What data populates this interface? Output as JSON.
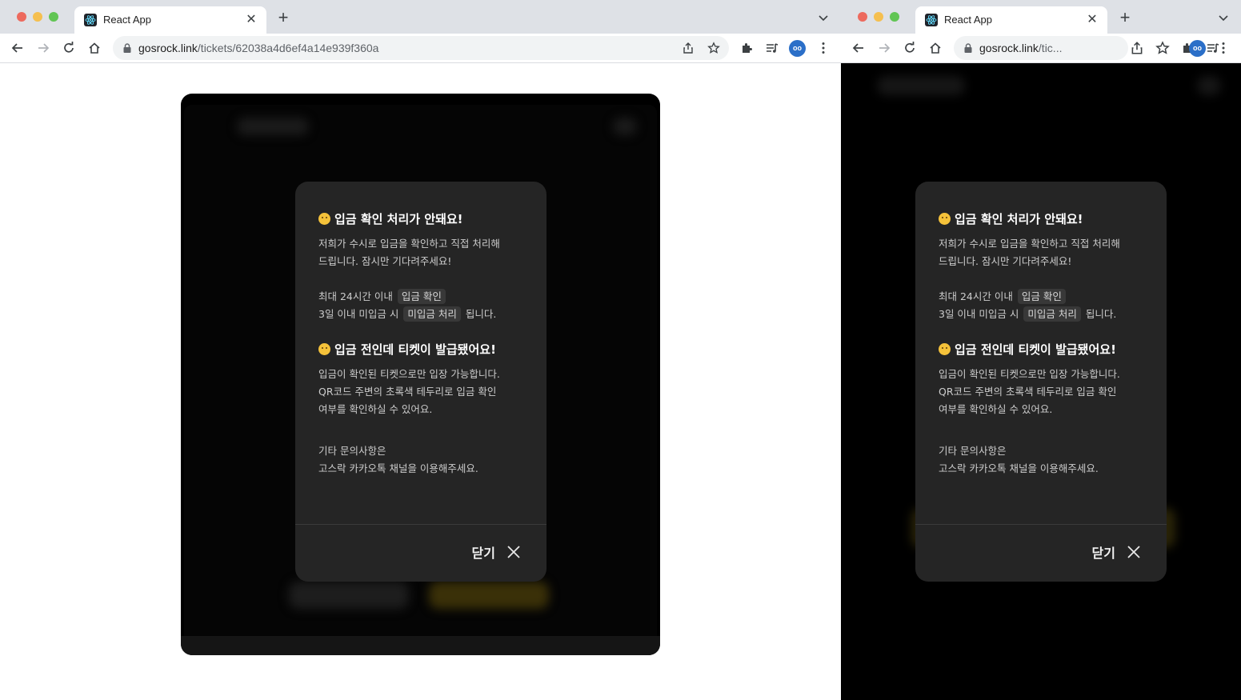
{
  "windows": [
    {
      "tab": {
        "title": "React App"
      },
      "address": {
        "host": "gosrock.link",
        "path": "/tickets/62038a4d6ef4a14e939f360a"
      },
      "avatar_text": "oo"
    },
    {
      "tab": {
        "title": "React App"
      },
      "address": {
        "host": "gosrock.link",
        "path": "/tic..."
      },
      "avatar_text": "oo"
    }
  ],
  "modal": {
    "section1": {
      "emoji_icon": "sad-face-emoji",
      "title": "입금 확인 처리가 안돼요!",
      "line1": "저희가 수시로 입금을 확인하고 직접 처리해",
      "line2": "드립니다. 잠시만 기다려주세요!",
      "row1_prefix": "최대 24시간 이내",
      "row1_chip": "입금 확인",
      "row2_prefix": "3일 이내 미입금 시",
      "row2_chip": "미입금 처리",
      "row2_suffix": "됩니다."
    },
    "section2": {
      "emoji_icon": "flushed-face-emoji",
      "title": "입금 전인데 티켓이 발급됐어요!",
      "line1": "입금이 확인된 티켓으로만 입장 가능합니다.",
      "line2": "QR코드 주변의 초록색 테두리로 입금 확인",
      "line3": "여부를 확인하실 수 있어요."
    },
    "contact": {
      "line1": "기타 문의사항은",
      "line2": "고스락 카카오톡 채널을 이용해주세요."
    },
    "close_label": "닫기"
  },
  "colors": {
    "modal_bg": "#252525",
    "chip_bg": "#383838",
    "accent_blur_yellow": "#d7b21c"
  }
}
